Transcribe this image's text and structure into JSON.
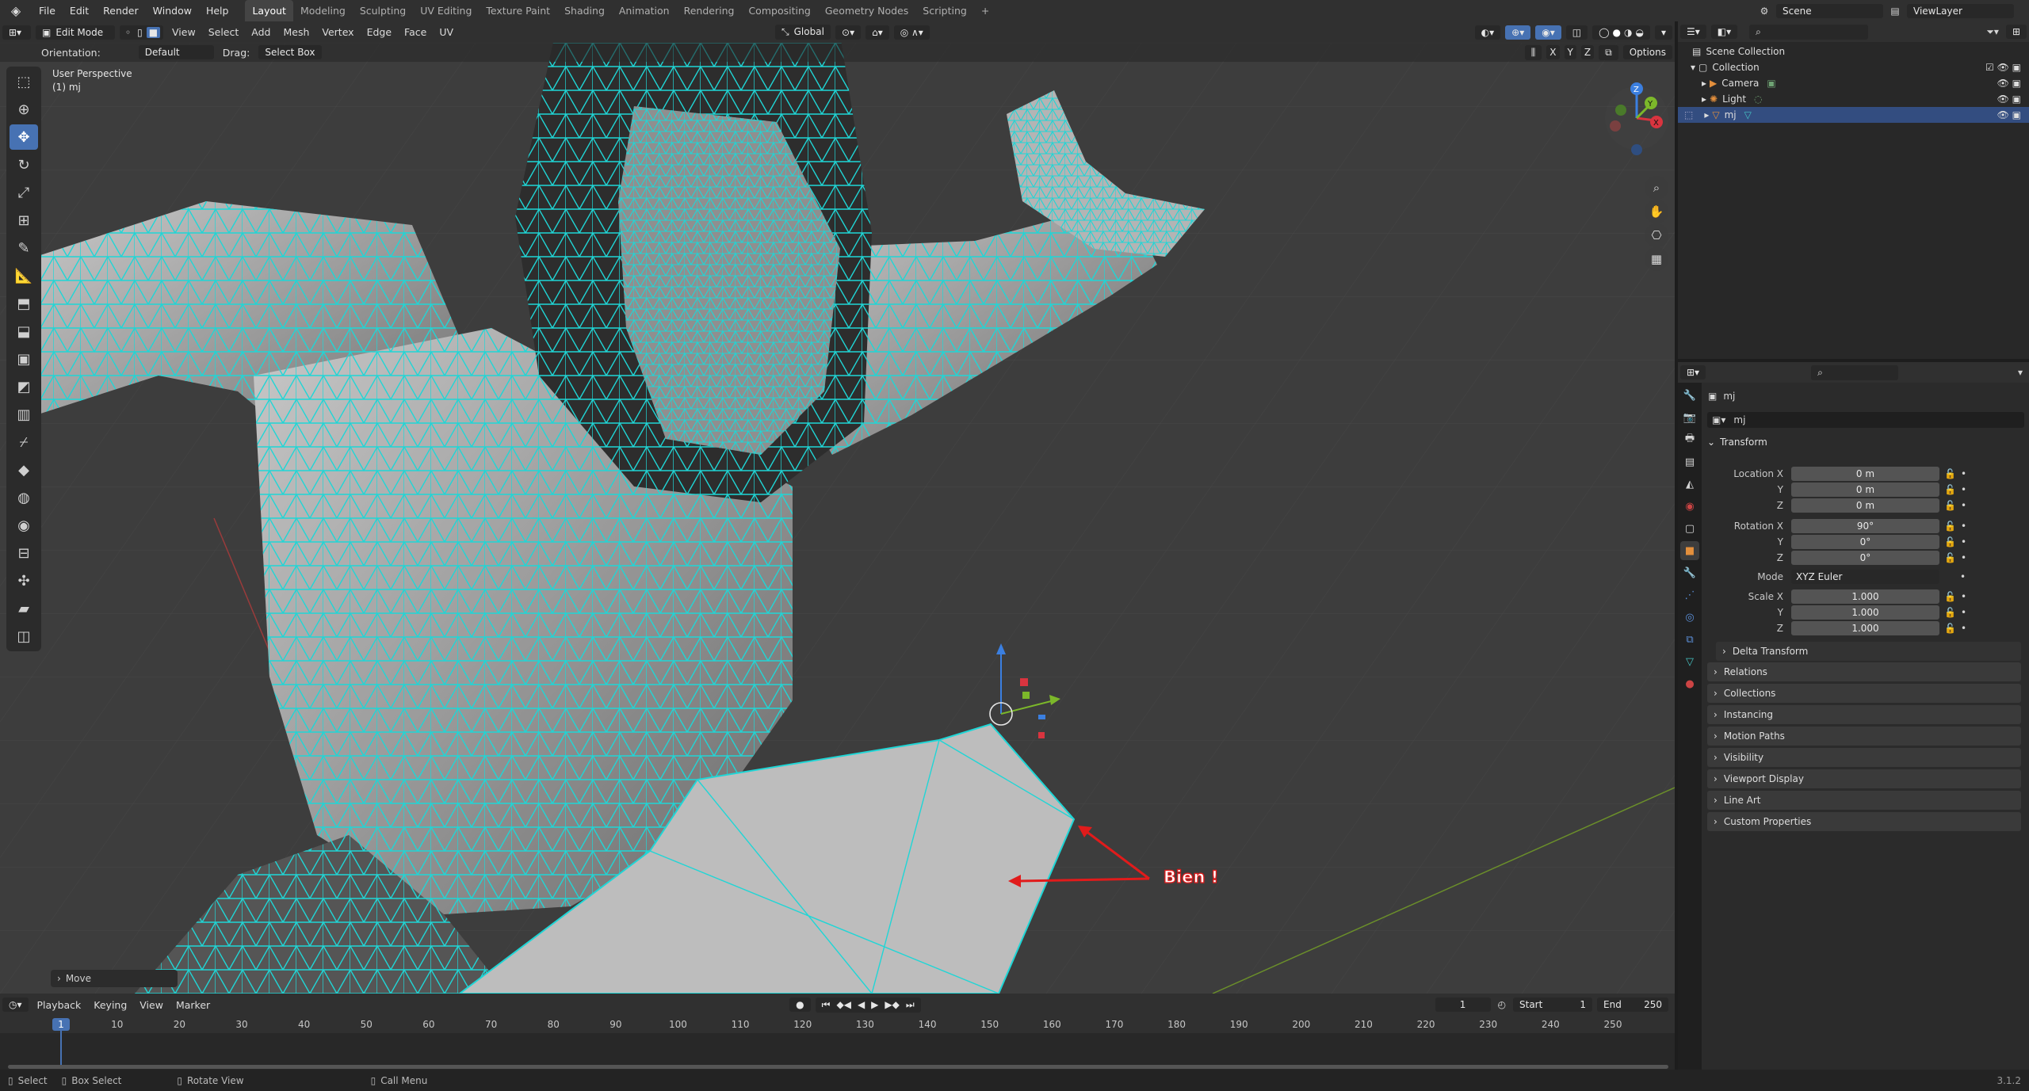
{
  "menubar": {
    "menus": [
      "File",
      "Edit",
      "Render",
      "Window",
      "Help"
    ],
    "workspaces": [
      "Layout",
      "Modeling",
      "Sculpting",
      "UV Editing",
      "Texture Paint",
      "Shading",
      "Animation",
      "Rendering",
      "Compositing",
      "Geometry Nodes",
      "Scripting"
    ],
    "active_workspace": "Layout",
    "scene": "Scene",
    "view_layer": "ViewLayer"
  },
  "viewport_header": {
    "mode": "Edit Mode",
    "menus": [
      "View",
      "Select",
      "Add",
      "Mesh",
      "Vertex",
      "Edge",
      "Face",
      "UV"
    ],
    "transform_orientation": "Global",
    "orientation_label": "Orientation:",
    "orientation_value": "Default",
    "drag_label": "Drag:",
    "drag_value": "Select Box",
    "axes": [
      "X",
      "Y",
      "Z"
    ],
    "options": "Options"
  },
  "viewport": {
    "view_name": "User Perspective",
    "object_info": "(1) mj",
    "annotation": "Bien !",
    "last_op": "Move",
    "colors": {
      "wire": "#1fd6d6",
      "annotation": "#e11b1b",
      "background": "#3d3d3d"
    }
  },
  "timeline": {
    "menus": [
      "Playback",
      "Keying",
      "View",
      "Marker"
    ],
    "current_frame": "1",
    "start_label": "Start",
    "start": "1",
    "end_label": "End",
    "end": "250",
    "ticks": [
      "1",
      "10",
      "20",
      "30",
      "40",
      "50",
      "60",
      "70",
      "80",
      "90",
      "100",
      "110",
      "120",
      "130",
      "140",
      "150",
      "160",
      "170",
      "180",
      "190",
      "200",
      "210",
      "220",
      "230",
      "240",
      "250"
    ]
  },
  "statusbar": {
    "items": [
      "Select",
      "Box Select",
      "Rotate View",
      "Call Menu"
    ],
    "version": "3.1.2"
  },
  "outliner": {
    "root": "Scene Collection",
    "collection": "Collection",
    "objects": [
      "Camera",
      "Light",
      "mj"
    ],
    "selected": "mj"
  },
  "properties": {
    "object_name": "mj",
    "data_name": "mj",
    "transform_title": "Transform",
    "location": {
      "label_x": "Location X",
      "x": "0 m",
      "y": "0 m",
      "z": "0 m"
    },
    "rotation": {
      "label_x": "Rotation X",
      "x": "90°",
      "y": "0°",
      "z": "0°"
    },
    "mode_label": "Mode",
    "mode_value": "XYZ Euler",
    "scale": {
      "label_x": "Scale X",
      "x": "1.000",
      "y": "1.000",
      "z": "1.000"
    },
    "axis_y": "Y",
    "axis_z": "Z",
    "delta_transform": "Delta Transform",
    "panels": [
      "Relations",
      "Collections",
      "Instancing",
      "Motion Paths",
      "Visibility",
      "Viewport Display",
      "Line Art",
      "Custom Properties"
    ]
  }
}
